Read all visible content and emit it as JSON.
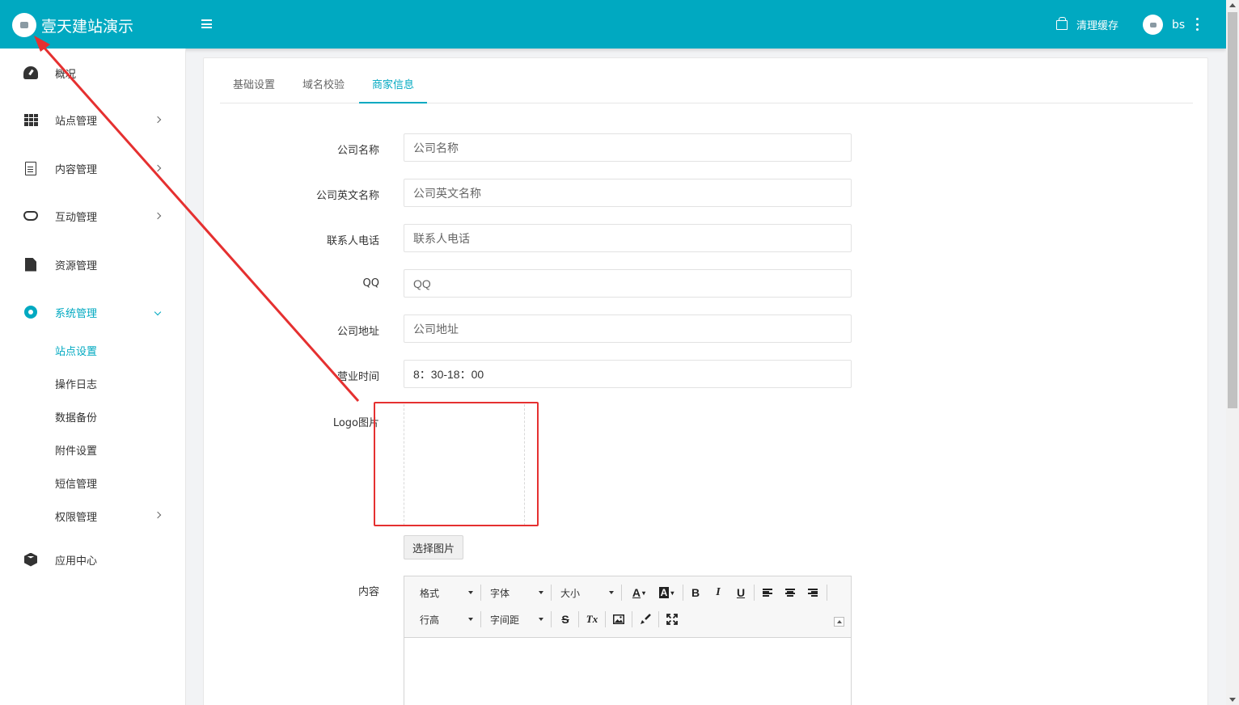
{
  "header": {
    "brand_name": "壹天建站演示",
    "clear_cache_label": "清理缓存",
    "username": "bs",
    "accent_color": "#00a9c1",
    "icons": [
      "brand-logo-icon",
      "hamburger-menu-icon",
      "basket-icon",
      "avatar",
      "more-vertical-icon"
    ]
  },
  "sidebar": {
    "items": [
      {
        "label": "概况",
        "icon": "dashboard-gauge-icon"
      },
      {
        "label": "站点管理",
        "icon": "grid-icon"
      },
      {
        "label": "内容管理",
        "icon": "document-icon"
      },
      {
        "label": "互动管理",
        "icon": "handshake-icon"
      },
      {
        "label": "资源管理",
        "icon": "file-icon"
      },
      {
        "label": "系统管理",
        "icon": "gear-icon"
      },
      {
        "label": "应用中心",
        "icon": "cube-icon"
      }
    ],
    "system_sub_items": [
      "站点设置",
      "操作日志",
      "数据备份",
      "附件设置",
      "短信管理",
      "权限管理"
    ]
  },
  "tabs": [
    "基础设置",
    "域名校验",
    "商家信息"
  ],
  "active_tab": "商家信息",
  "form": {
    "fields": [
      {
        "label": "公司名称",
        "placeholder": "公司名称",
        "value": ""
      },
      {
        "label": "公司英文名称",
        "placeholder": "公司英文名称",
        "value": ""
      },
      {
        "label": "联系人电话",
        "placeholder": "联系人电话",
        "value": ""
      },
      {
        "label": "QQ",
        "placeholder": "QQ",
        "value": ""
      },
      {
        "label": "公司地址",
        "placeholder": "公司地址",
        "value": ""
      },
      {
        "label": "营业时间",
        "placeholder": "",
        "value": "8：30-18：00"
      }
    ],
    "logo_label": "Logo图片",
    "select_image_label": "选择图片",
    "content_label": "内容"
  },
  "editor": {
    "format_label": "格式",
    "font_label": "字体",
    "size_label": "大小",
    "line_height_label": "行高",
    "letter_spacing_label": "字间距",
    "bold": "B",
    "italic": "I",
    "underline": "U",
    "strike": "S",
    "clear_format": "Tx",
    "font_color": "A",
    "bg_color": "A"
  },
  "annotation": {
    "color": "#e53030"
  }
}
